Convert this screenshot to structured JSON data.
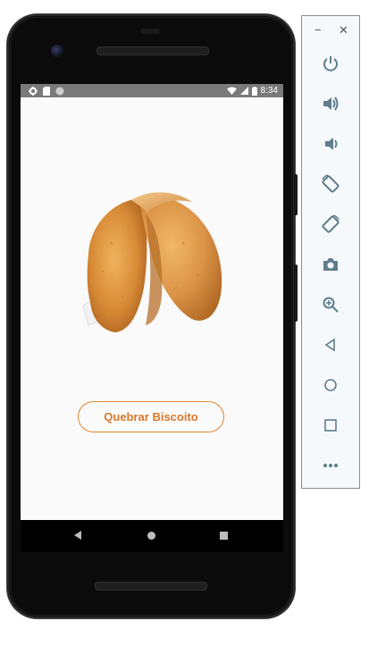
{
  "status_bar": {
    "time": "8:34"
  },
  "app": {
    "button_label": "Quebrar Biscoito",
    "image_subject": "fortune-cookie",
    "accent_color": "#e0822e"
  },
  "emulator_panel": {
    "window_controls": [
      "minimize-icon",
      "close-icon"
    ],
    "tools": [
      "power-icon",
      "volume-up-icon",
      "volume-down-icon",
      "rotate-left-icon",
      "rotate-right-icon",
      "camera-icon",
      "zoom-icon",
      "back-icon",
      "home-icon",
      "overview-icon",
      "more-icon"
    ]
  },
  "nav_bar": {
    "buttons": [
      "back-icon",
      "home-icon",
      "recents-icon"
    ]
  }
}
